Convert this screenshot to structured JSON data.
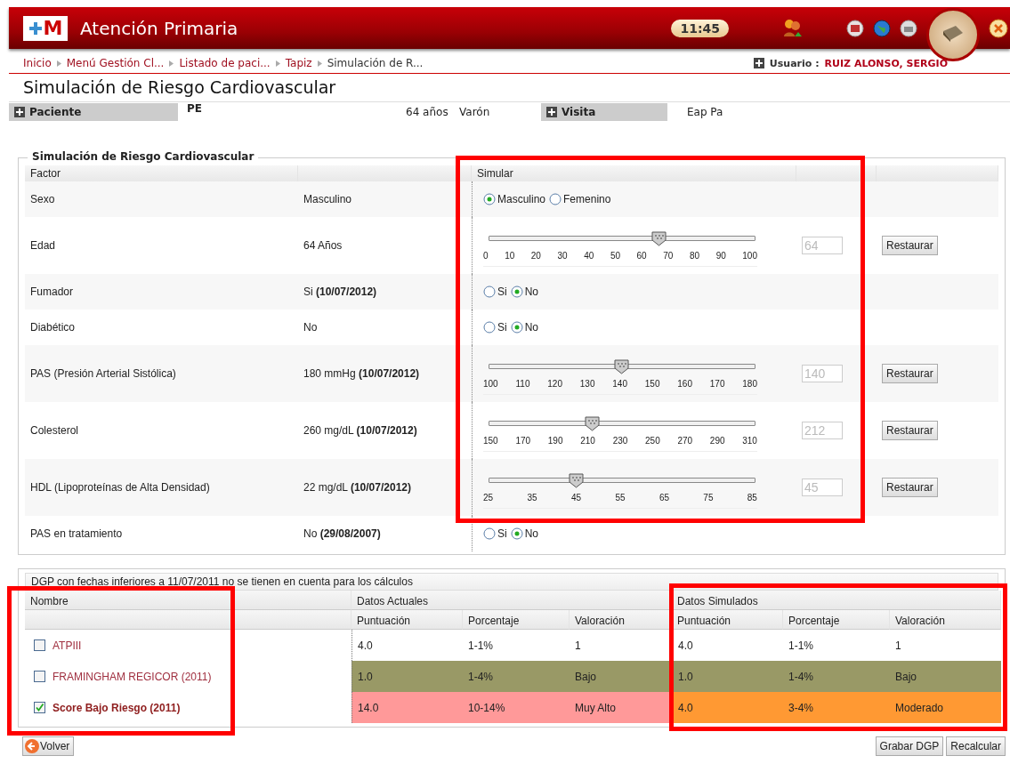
{
  "header": {
    "logo": "M",
    "title": "Atención Primaria",
    "clock": "11:45"
  },
  "breadcrumb": [
    "Inicio",
    "Menú Gestión Cl...",
    "Listado de paci...",
    "Tapiz",
    "Simulación de R..."
  ],
  "user": {
    "label": "Usuario :",
    "name": "RUIZ ALONSO, SERGIO"
  },
  "page_title": "Simulación de Riesgo Cardiovascular",
  "patient_bar": {
    "patient_label": "Paciente",
    "patient_name": "PE",
    "age": "64 años",
    "sex": "Varón",
    "visit_label": "Visita",
    "visit": "Eap Pa"
  },
  "simulation": {
    "legend": "Simulación de Riesgo Cardiovascular",
    "columns": [
      "Factor",
      "Simular"
    ],
    "highlighted": true,
    "rows": [
      {
        "kind": "radio",
        "factor": "Sexo",
        "current": "Masculino",
        "options": [
          {
            "label": "Masculino",
            "selected": true
          },
          {
            "label": "Femenino",
            "selected": false
          }
        ]
      },
      {
        "kind": "slider",
        "factor": "Edad",
        "current": "64 Años",
        "ticks": [
          "0",
          "10",
          "20",
          "30",
          "40",
          "50",
          "60",
          "70",
          "80",
          "90",
          "100"
        ],
        "level": 0.64,
        "input": {
          "value": "64",
          "disabled": true
        },
        "button": "Restaurar"
      },
      {
        "kind": "radio",
        "factor": "Fumador",
        "current": "Si **(10/07/2012)**",
        "options": [
          {
            "label": "Si",
            "selected": false
          },
          {
            "label": "No",
            "selected": true
          }
        ]
      },
      {
        "kind": "radio",
        "factor": "Diabético",
        "current": "No",
        "options": [
          {
            "label": "Si",
            "selected": false
          },
          {
            "label": "No",
            "selected": true
          }
        ]
      },
      {
        "kind": "slider",
        "factor": "PAS (Presión Arterial Sistólica)",
        "current": "180 mmHg **(10/07/2012)**",
        "ticks": [
          "100",
          "110",
          "120",
          "130",
          "140",
          "150",
          "160",
          "170",
          "180"
        ],
        "level": 0.5,
        "input": {
          "value": "140",
          "disabled": true
        },
        "button": "Restaurar"
      },
      {
        "kind": "slider",
        "factor": "Colesterol",
        "current": "260 mg/dL **(10/07/2012)**",
        "ticks": [
          "150",
          "170",
          "190",
          "210",
          "230",
          "250",
          "270",
          "290",
          "310"
        ],
        "level": 0.39,
        "input": {
          "value": "212",
          "disabled": true
        },
        "button": "Restaurar"
      },
      {
        "kind": "slider",
        "factor": "HDL (Lipoproteínas de Alta Densidad)",
        "current": "22 mg/dL **(10/07/2012)**",
        "ticks": [
          "25",
          "35",
          "45",
          "55",
          "65",
          "75",
          "85"
        ],
        "level": 0.33,
        "input": {
          "value": "45",
          "disabled": true
        },
        "button": "Restaurar"
      },
      {
        "kind": "radio",
        "factor": "PAS en tratamiento",
        "current": "No **(29/08/2007)**",
        "options": [
          {
            "label": "Si",
            "selected": false
          },
          {
            "label": "No",
            "selected": true
          }
        ]
      }
    ]
  },
  "dgp": {
    "notice": "DGP con fechas inferiores a 11/07/2011 no se tienen en cuenta para los cálculos",
    "name_column": "Nombre",
    "current_group": "Datos Actuales",
    "simulated_group": "Datos Simulados",
    "current_columns": [
      "Puntuación",
      "Porcentaje",
      "Valoración"
    ],
    "simulated_columns": [
      "Puntuación",
      "Porcentaje",
      "Valoración"
    ],
    "names_highlighted": true,
    "simulated_highlighted": true,
    "rows": [
      {
        "name": "ATPIII",
        "checked": false,
        "current": {
          "color": "#ffffff",
          "values": [
            "4.0",
            "1-1%",
            "1"
          ]
        },
        "simulated": {
          "color": "#ffffff",
          "values": [
            "4.0",
            "1-1%",
            "1"
          ]
        }
      },
      {
        "name": "FRAMINGHAM REGICOR (2011)",
        "checked": false,
        "current": {
          "color": "#999966",
          "values": [
            "1.0",
            "1-4%",
            "Bajo"
          ]
        },
        "simulated": {
          "color": "#999966",
          "values": [
            "1.0",
            "1-4%",
            "Bajo"
          ]
        }
      },
      {
        "name": "Score Bajo Riesgo (2011)",
        "checked": true,
        "current": {
          "color": "#ff9999",
          "values": [
            "14.0",
            "10-14%",
            "Muy Alto"
          ]
        },
        "simulated": {
          "color": "#ff9933",
          "values": [
            "4.0",
            "3-4%",
            "Moderado"
          ]
        }
      }
    ]
  },
  "buttons": {
    "back": "Volver",
    "save": "Grabar DGP",
    "recalc": "Recalcular"
  }
}
